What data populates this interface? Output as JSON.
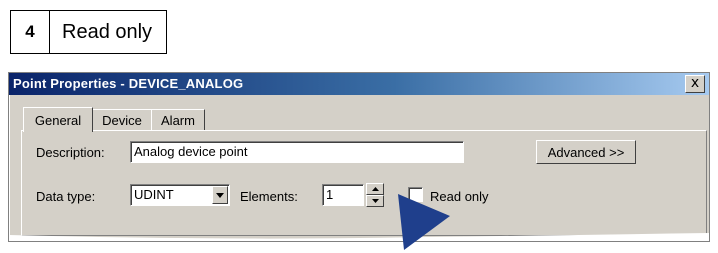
{
  "callout": {
    "number": "4",
    "text": "Read only"
  },
  "dialog": {
    "title": "Point Properties - DEVICE_ANALOG",
    "close_label": "x",
    "tabs": [
      {
        "label": "General",
        "active": true
      },
      {
        "label": "Device",
        "active": false
      },
      {
        "label": "Alarm",
        "active": false
      }
    ],
    "description": {
      "label": "Description:",
      "value": "Analog device point"
    },
    "advanced_button": "Advanced >>",
    "data_type": {
      "label": "Data type:",
      "value": "UDINT"
    },
    "elements": {
      "label": "Elements:",
      "value": "1"
    },
    "read_only": {
      "label": "Read only",
      "checked": false
    }
  },
  "colors": {
    "title_bar": "#0a246a",
    "dialog_face": "#d4d0c8",
    "pointer": "#1f3f8c"
  },
  "icons": [
    "close-icon",
    "dropdown-arrow-icon",
    "spin-up-icon",
    "spin-down-icon",
    "pointer-arrow-icon"
  ]
}
